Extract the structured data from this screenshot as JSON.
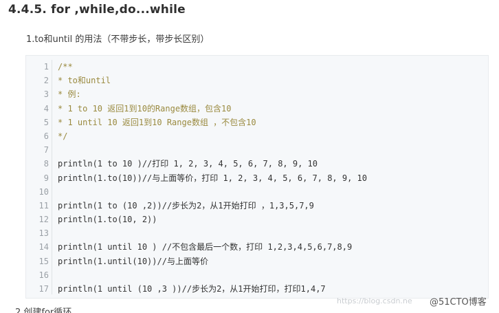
{
  "heading": "4.4.5. for ,while,do...while",
  "subheading": "1.to和until 的用法（不带步长，带步长区别）",
  "code": {
    "lines": [
      {
        "n": "1",
        "text": "/**",
        "kind": "comment"
      },
      {
        "n": "2",
        "text": " * to和until",
        "kind": "comment"
      },
      {
        "n": "3",
        "text": " * 例:",
        "kind": "comment"
      },
      {
        "n": "4",
        "text": " * 1 to 10 返回1到10的Range数组，包含10",
        "kind": "comment"
      },
      {
        "n": "5",
        "text": " * 1 until 10 返回1到10 Range数组 ，不包含10",
        "kind": "comment"
      },
      {
        "n": "6",
        "text": " */",
        "kind": "comment"
      },
      {
        "n": "7",
        "text": "",
        "kind": "code"
      },
      {
        "n": "8",
        "text": "println(1 to 10 )//打印 1, 2, 3, 4, 5, 6, 7, 8, 9, 10",
        "kind": "code"
      },
      {
        "n": "9",
        "text": "println(1.to(10))//与上面等价，打印 1, 2, 3, 4, 5, 6, 7, 8, 9, 10",
        "kind": "code"
      },
      {
        "n": "10",
        "text": "",
        "kind": "code"
      },
      {
        "n": "11",
        "text": "println(1 to (10 ,2))//步长为2，从1开始打印 ，1,3,5,7,9",
        "kind": "code"
      },
      {
        "n": "12",
        "text": "println(1.to(10, 2))",
        "kind": "code"
      },
      {
        "n": "13",
        "text": "",
        "kind": "code"
      },
      {
        "n": "14",
        "text": "println(1 until 10 ) //不包含最后一个数，打印 1,2,3,4,5,6,7,8,9",
        "kind": "code"
      },
      {
        "n": "15",
        "text": "println(1.until(10))//与上面等价",
        "kind": "code"
      },
      {
        "n": "16",
        "text": "",
        "kind": "code"
      },
      {
        "n": "17",
        "text": "println(1 until (10 ,3 ))//步长为2，从1开始打印，打印1,4,7",
        "kind": "code"
      }
    ]
  },
  "next_item_partial": "2.创建for循环",
  "watermark": {
    "url": "https://blog.csdn.ne",
    "brand": "@51CTO博客"
  },
  "colors": {
    "code_bg": "#f6f8fa",
    "comment": "#9a8a3f",
    "line_number": "#9aa0a6"
  }
}
